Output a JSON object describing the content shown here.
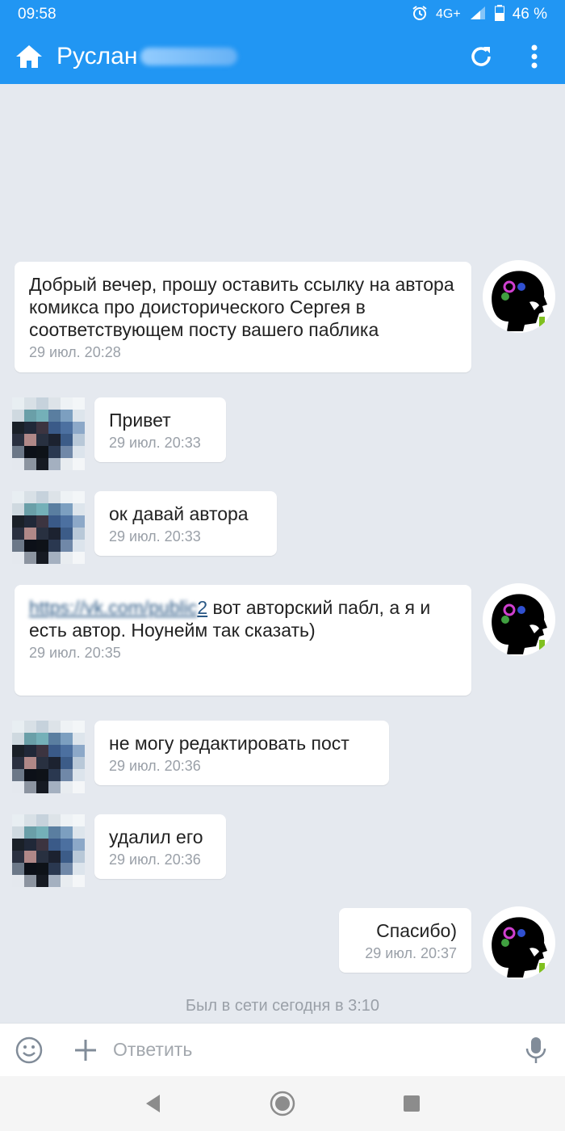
{
  "status_bar": {
    "time": "09:58",
    "network": "4G+",
    "battery": "46 %"
  },
  "header": {
    "title": "Руслан"
  },
  "messages": [
    {
      "text": "Добрый вечер, прошу оставить ссылку на автора комикса про доисторического Сергея в соответствующем посту вашего паблика",
      "time": "29 июл. 20:28",
      "side": "outgoing"
    },
    {
      "text": "Привет",
      "time": "29 июл. 20:33",
      "side": "incoming"
    },
    {
      "text": "ок давай автора",
      "time": "29 июл. 20:33",
      "side": "incoming"
    },
    {
      "link": "https://vk.com/public",
      "link_suffix": "2",
      "text": " вот авторский пабл, а я и есть автор. Ноунейм так сказать)",
      "time": "29 июл. 20:35",
      "side": "outgoing"
    },
    {
      "text": "не могу редактировать пост",
      "time": "29 июл. 20:36",
      "side": "incoming"
    },
    {
      "text": "удалил его",
      "time": "29 июл. 20:36",
      "side": "incoming"
    },
    {
      "text": "Спасибо)",
      "time": "29 июл. 20:37",
      "side": "outgoing"
    }
  ],
  "last_seen": "Был в сети сегодня в 3:10",
  "composer": {
    "placeholder": "Ответить"
  },
  "colors": {
    "accent": "#2196f3",
    "background": "#e5e9ef",
    "bubble": "#ffffff",
    "timestamp": "#9aa0a8",
    "link": "#2a5885"
  },
  "icons": {
    "home": "home-icon",
    "refresh": "refresh-icon",
    "menu": "more-vert-icon",
    "emoji": "smile-icon",
    "attach": "plus-icon",
    "voice": "mic-icon",
    "back": "back-triangle-icon",
    "home_nav": "home-circle-icon",
    "recents": "square-icon"
  }
}
